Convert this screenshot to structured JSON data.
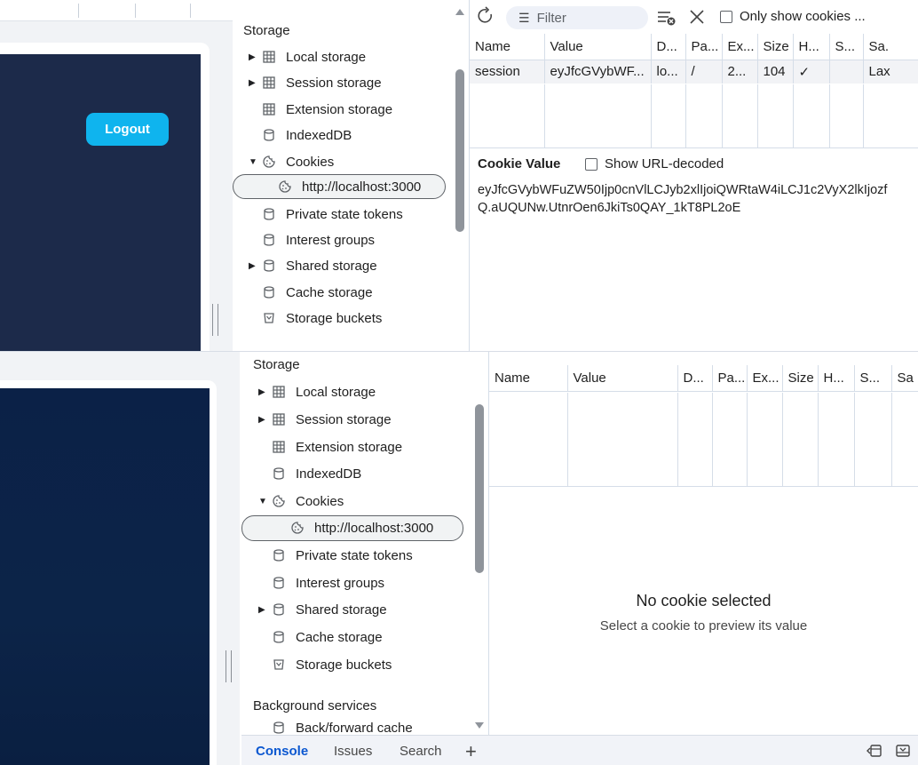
{
  "webpage": {
    "logout_label": "Logout"
  },
  "sidebar": {
    "section_storage": "Storage",
    "items": [
      {
        "label": "Local storage",
        "icon": "grid-icon",
        "expandable": true
      },
      {
        "label": "Session storage",
        "icon": "grid-icon",
        "expandable": true
      },
      {
        "label": "Extension storage",
        "icon": "grid-icon",
        "expandable": false
      },
      {
        "label": "IndexedDB",
        "icon": "database-icon",
        "expandable": false
      },
      {
        "label": "Cookies",
        "icon": "cookie-icon",
        "expandable": true,
        "expanded": true
      },
      {
        "label": "http://localhost:3000",
        "icon": "cookie-icon",
        "selected": true
      },
      {
        "label": "Private state tokens",
        "icon": "database-icon",
        "expandable": false
      },
      {
        "label": "Interest groups",
        "icon": "database-icon",
        "expandable": false
      },
      {
        "label": "Shared storage",
        "icon": "database-icon",
        "expandable": true
      },
      {
        "label": "Cache storage",
        "icon": "database-icon",
        "expandable": false
      },
      {
        "label": "Storage buckets",
        "icon": "bucket-icon",
        "expandable": false
      }
    ],
    "section_background": "Background services",
    "partial_item": "Back/forward cache"
  },
  "toolbar": {
    "filter_placeholder": "Filter",
    "only_show_label": "Only show cookies ..."
  },
  "cookie_table": {
    "columns_top": [
      "Name",
      "Value",
      "D...",
      "Pa...",
      "Ex...",
      "Size",
      "H...",
      "S...",
      "Sa."
    ],
    "columns_bottom": [
      "Name",
      "Value",
      "D...",
      "Pa...",
      "Ex...",
      "Size",
      "H...",
      "S...",
      "Sa"
    ],
    "rows": [
      {
        "name": "session",
        "value": "eyJfcGVybWF...",
        "domain": "lo...",
        "path": "/",
        "expires": "2...",
        "size": "104",
        "httponly": "✓",
        "secure": "",
        "samesite": "Lax"
      }
    ]
  },
  "cookie_value": {
    "label": "Cookie Value",
    "show_url_decoded": "Show URL-decoded",
    "value": "eyJfcGVybWFuZW50Ijp0cnVlLCJyb2xlIjoiQWRtaW4iLCJ1c2VyX2lkIjozfQ.aUQUNw.UtnrOen6JkiTs0QAY_1kT8PL2oE"
  },
  "empty_state": {
    "title": "No cookie selected",
    "subtitle": "Select a cookie to preview its value"
  },
  "drawer": {
    "tabs": [
      "Console",
      "Issues",
      "Search"
    ],
    "active_tab": "Console"
  },
  "colors": {
    "logout_button": "#0fb4ee",
    "page_navy": "#1c2a4a",
    "page_navy_dark": "#0b2147",
    "accent": "#0b57d0"
  }
}
